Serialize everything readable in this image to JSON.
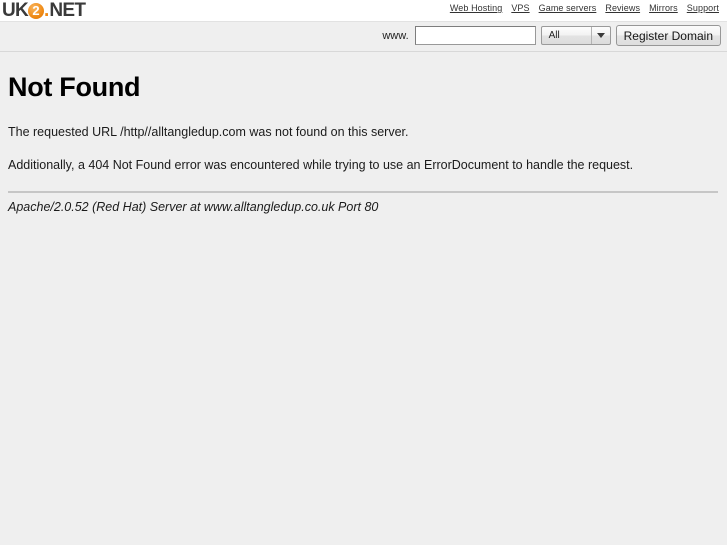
{
  "header": {
    "logo": {
      "prefix": "UK",
      "circle_digit": "2",
      "dot": ".",
      "suffix": "NET",
      "accent_color": "#ef8a15"
    },
    "nav": [
      {
        "label": "Web Hosting"
      },
      {
        "label": "VPS"
      },
      {
        "label": "Game servers"
      },
      {
        "label": "Reviews"
      },
      {
        "label": "Mirrors"
      },
      {
        "label": "Support"
      }
    ]
  },
  "search": {
    "prefix_label": "www.",
    "input_value": "",
    "input_placeholder": "",
    "tld_selected": "All",
    "tld_options": [
      "All"
    ],
    "submit_label": "Register Domain"
  },
  "error": {
    "title": "Not Found",
    "message_1": "The requested URL /http//alltangledup.com was not found on this server.",
    "message_2": "Additionally, a 404 Not Found error was encountered while trying to use an ErrorDocument to handle the request.",
    "server_signature": "Apache/2.0.52 (Red Hat) Server at www.alltangledup.co.uk Port 80"
  },
  "colors": {
    "page_background": "#efefef",
    "header_background": "#ffffff",
    "accent": "#ef8a15",
    "text": "#1b1b1b"
  }
}
